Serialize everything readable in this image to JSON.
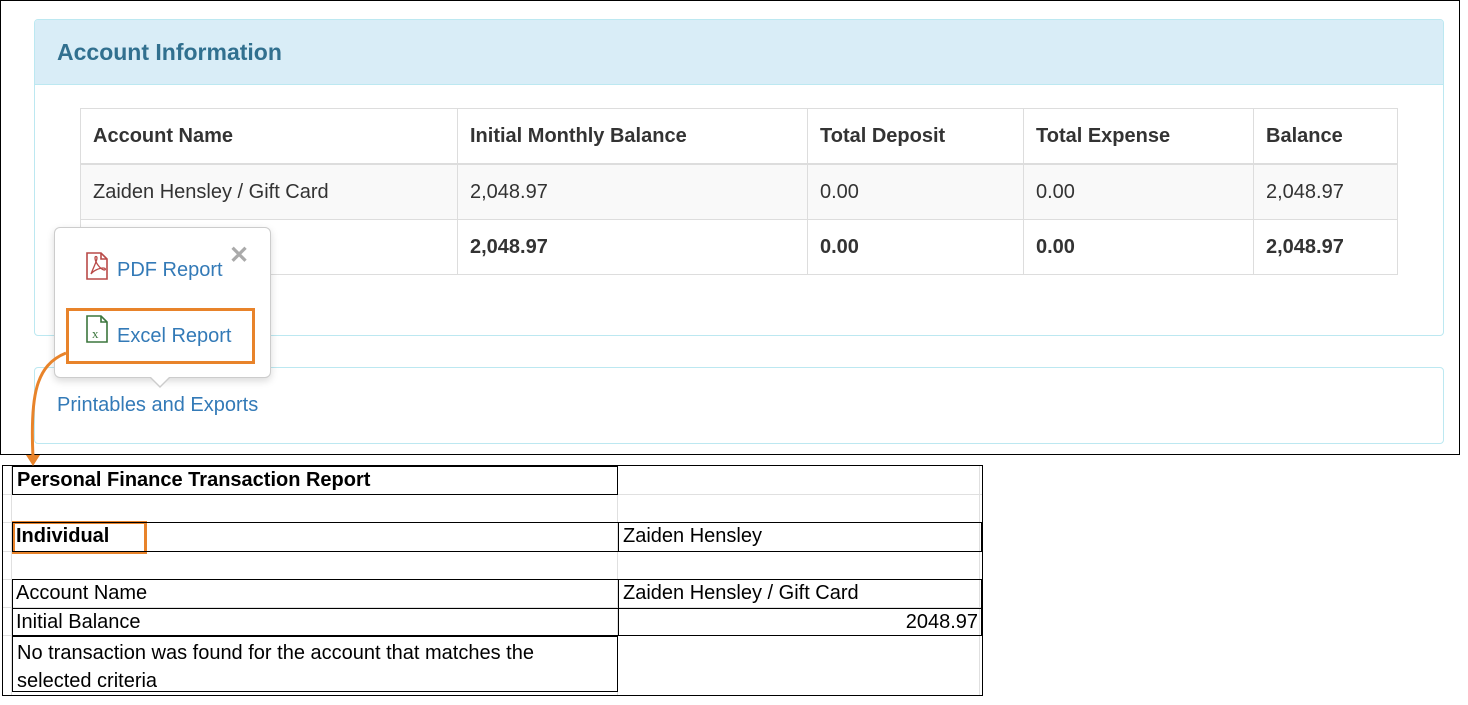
{
  "panel": {
    "title": "Account Information",
    "table": {
      "headers": [
        "Account Name",
        "Initial Monthly Balance",
        "Total Deposit",
        "Total Expense",
        "Balance"
      ],
      "rows": [
        [
          "Zaiden Hensley / Gift Card",
          "2,048.97",
          "0.00",
          "0.00",
          "2,048.97"
        ]
      ],
      "totals": [
        "",
        "2,048.97",
        "0.00",
        "0.00",
        "2,048.97"
      ]
    }
  },
  "popover": {
    "pdf_label": "PDF Report",
    "excel_label": "Excel Report",
    "close_icon": "close-icon",
    "pdf_icon": "pdf-file-icon",
    "excel_icon": "excel-file-icon"
  },
  "printables": {
    "link_label": "Printables and Exports"
  },
  "colors": {
    "highlight": "#e8832a",
    "panel_heading_bg": "#d9edf7",
    "panel_heading_text": "#31708f",
    "link": "#337ab7"
  },
  "spreadsheet": {
    "title": "Personal Finance Transaction Report",
    "individual_label": "Individual",
    "individual_value": "Zaiden Hensley",
    "account_name_label": "Account Name",
    "account_name_value": "Zaiden Hensley / Gift Card",
    "initial_balance_label": "Initial Balance",
    "initial_balance_value": "2048.97",
    "no_transaction_line1": "No transaction was found for the account that matches the",
    "no_transaction_line2": "selected criteria"
  }
}
